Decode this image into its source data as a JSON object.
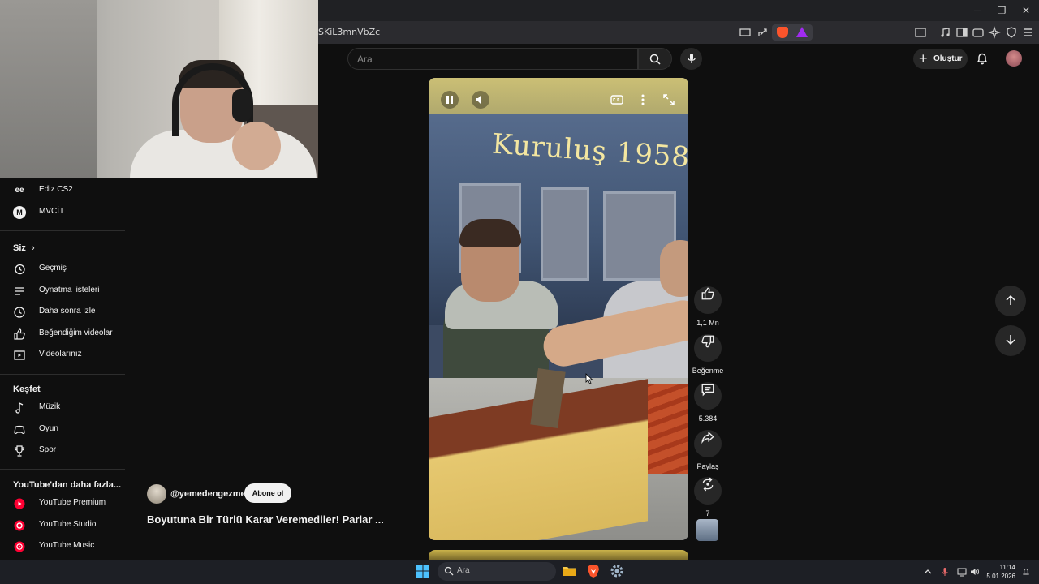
{
  "browser": {
    "url": "SKiL3mnVbZc",
    "window_buttons": {
      "minimize": "─",
      "restore": "❐",
      "close": "✕"
    }
  },
  "header": {
    "search_placeholder": "Ara",
    "create_label": "Oluştur",
    "create_icon": "+"
  },
  "sidebar": {
    "subscriptions": [
      {
        "label": "Ediz CS2",
        "icon": "channel-logo-ee",
        "logo_text": "ee"
      },
      {
        "label": "MVCİT",
        "icon": "channel-logo-m",
        "logo_text": "M"
      }
    ],
    "you_section": {
      "title": "Siz",
      "chevron": "›",
      "items": [
        {
          "label": "Geçmiş",
          "icon": "history-icon"
        },
        {
          "label": "Oynatma listeleri",
          "icon": "playlist-icon"
        },
        {
          "label": "Daha sonra izle",
          "icon": "clock-icon"
        },
        {
          "label": "Beğendiğim videolar",
          "icon": "thumbs-up-icon"
        },
        {
          "label": "Videolarınız",
          "icon": "video-icon"
        }
      ]
    },
    "explore_section": {
      "title": "Keşfet",
      "items": [
        {
          "label": "Müzik",
          "icon": "music-note-icon"
        },
        {
          "label": "Oyun",
          "icon": "gamepad-icon"
        },
        {
          "label": "Spor",
          "icon": "trophy-icon"
        }
      ]
    },
    "more_section": {
      "title": "YouTube'dan daha fazla...",
      "items": [
        {
          "label": "YouTube Premium",
          "icon": "youtube-premium-icon"
        },
        {
          "label": "YouTube Studio",
          "icon": "youtube-studio-icon"
        },
        {
          "label": "YouTube Music",
          "icon": "youtube-music-icon"
        }
      ]
    }
  },
  "short": {
    "sign_text": "Kuruluş 1958",
    "channel_handle": "@yemedengezme",
    "subscribe_label": "Abone ol",
    "title": "Boyutuna Bir Türlü Karar Veremediler! Parlar ...",
    "actions": {
      "like_count": "1,1 Mn",
      "dislike_label": "Beğenme",
      "comment_count": "5.384",
      "share_label": "Paylaş",
      "remix_count": "7"
    }
  },
  "taskbar": {
    "search_placeholder": "Ara",
    "time": "11:14",
    "date": "5.01.2026"
  },
  "colors": {
    "background": "#0f0f0f",
    "accent_red": "#ff0033",
    "surface": "#272727"
  }
}
